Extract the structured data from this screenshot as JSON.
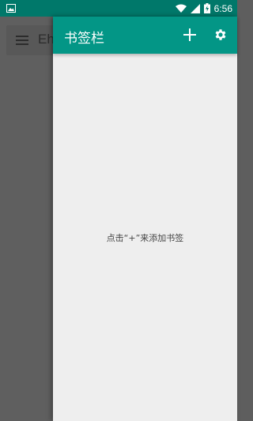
{
  "statusbar": {
    "time": "6:56",
    "battery_icon": "battery-charging-icon",
    "signal_icon": "signal-icon",
    "wifi_icon": "wifi-icon"
  },
  "background_app": {
    "title": "Eh",
    "menu_icon": "hamburger-menu-icon"
  },
  "drawer": {
    "title": "书签栏",
    "add_icon": "plus-icon",
    "settings_icon": "gear-icon",
    "empty_message": "点击“+”来添加书签"
  },
  "colors": {
    "statusbar": "#00786a",
    "toolbar": "#039686",
    "drawer_bg": "#eeeeee",
    "scrim": "#5f5f5f"
  }
}
